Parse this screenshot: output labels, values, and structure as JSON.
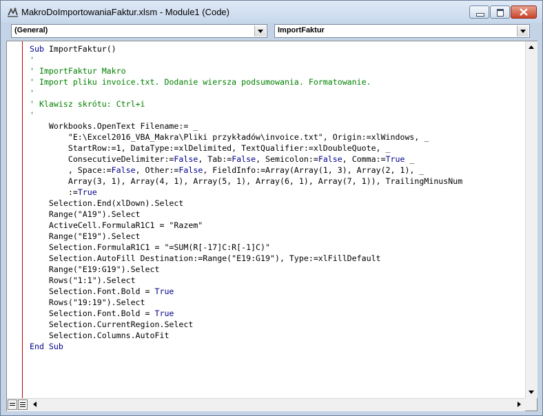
{
  "window": {
    "title": "MakroDoImportowaniaFaktur.xlsm - Module1 (Code)",
    "icon": "vba-project-icon"
  },
  "combos": {
    "object": "(General)",
    "procedure": "ImportFaktur"
  },
  "code": [
    [
      {
        "t": "Sub",
        "c": "kw"
      },
      {
        "t": " ImportFaktur()"
      }
    ],
    [
      {
        "t": "'",
        "c": "cm"
      }
    ],
    [
      {
        "t": "' ImportFaktur Makro",
        "c": "cm"
      }
    ],
    [
      {
        "t": "' Import pliku invoice.txt. Dodanie wiersza podsumowania. Formatowanie.",
        "c": "cm"
      }
    ],
    [
      {
        "t": "'",
        "c": "cm"
      }
    ],
    [
      {
        "t": "' Klawisz skrótu: Ctrl+i",
        "c": "cm"
      }
    ],
    [
      {
        "t": "'",
        "c": "cm"
      }
    ],
    [
      {
        "t": "    Workbooks.OpenText Filename:= _"
      }
    ],
    [
      {
        "t": "        \"E:\\Excel2016_VBA_Makra\\Pliki przykładów\\invoice.txt\", Origin:=xlWindows, _"
      }
    ],
    [
      {
        "t": "        StartRow:=1, DataType:=xlDelimited, TextQualifier:=xlDoubleQuote, _"
      }
    ],
    [
      {
        "t": "        ConsecutiveDelimiter:="
      },
      {
        "t": "False",
        "c": "kw"
      },
      {
        "t": ", Tab:="
      },
      {
        "t": "False",
        "c": "kw"
      },
      {
        "t": ", Semicolon:="
      },
      {
        "t": "False",
        "c": "kw"
      },
      {
        "t": ", Comma:="
      },
      {
        "t": "True",
        "c": "kw"
      },
      {
        "t": " _"
      }
    ],
    [
      {
        "t": "        , Space:="
      },
      {
        "t": "False",
        "c": "kw"
      },
      {
        "t": ", Other:="
      },
      {
        "t": "False",
        "c": "kw"
      },
      {
        "t": ", FieldInfo:=Array(Array(1, 3), Array(2, 1), _"
      }
    ],
    [
      {
        "t": "        Array(3, 1), Array(4, 1), Array(5, 1), Array(6, 1), Array(7, 1)), TrailingMinusNum"
      }
    ],
    [
      {
        "t": "        :="
      },
      {
        "t": "True",
        "c": "kw"
      }
    ],
    [
      {
        "t": "    Selection.End(xlDown).Select"
      }
    ],
    [
      {
        "t": "    Range(\"A19\").Select"
      }
    ],
    [
      {
        "t": "    ActiveCell.FormulaR1C1 = \"Razem\""
      }
    ],
    [
      {
        "t": "    Range(\"E19\").Select"
      }
    ],
    [
      {
        "t": "    Selection.FormulaR1C1 = \"=SUM(R[-17]C:R[-1]C)\""
      }
    ],
    [
      {
        "t": "    Selection.AutoFill Destination:=Range(\"E19:G19\"), Type:=xlFillDefault"
      }
    ],
    [
      {
        "t": "    Range(\"E19:G19\").Select"
      }
    ],
    [
      {
        "t": "    Rows(\"1:1\").Select"
      }
    ],
    [
      {
        "t": "    Selection.Font.Bold = "
      },
      {
        "t": "True",
        "c": "kw"
      }
    ],
    [
      {
        "t": "    Rows(\"19:19\").Select"
      }
    ],
    [
      {
        "t": "    Selection.Font.Bold = "
      },
      {
        "t": "True",
        "c": "kw"
      }
    ],
    [
      {
        "t": "    Selection.CurrentRegion.Select"
      }
    ],
    [
      {
        "t": "    Selection.Columns.AutoFit"
      }
    ],
    [
      {
        "t": "End Sub",
        "c": "kw"
      }
    ]
  ],
  "colors": {
    "keyword": "#00008b",
    "comment": "#008000",
    "margin_line": "#c00000"
  }
}
